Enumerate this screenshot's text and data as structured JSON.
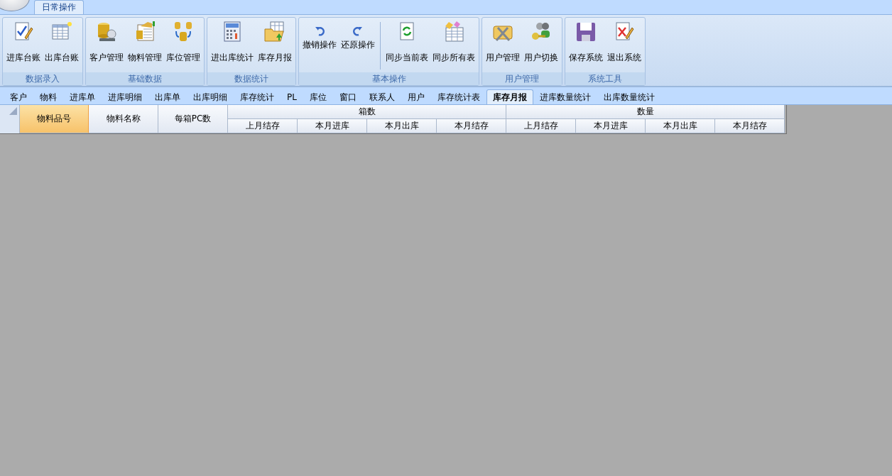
{
  "ribbon_tabs": [
    {
      "label": "日常操作",
      "selected": true
    }
  ],
  "ribbon_groups": [
    {
      "title": "数据录入",
      "buttons": [
        {
          "label": "进库台账",
          "kind": "large"
        },
        {
          "label": "出库台账",
          "kind": "large"
        }
      ]
    },
    {
      "title": "基础数据",
      "buttons": [
        {
          "label": "客户管理",
          "kind": "large"
        },
        {
          "label": "物料管理",
          "kind": "large"
        },
        {
          "label": "库位管理",
          "kind": "large"
        }
      ]
    },
    {
      "title": "数据统计",
      "buttons": [
        {
          "label": "进出库统计",
          "kind": "large"
        },
        {
          "label": "库存月报",
          "kind": "large"
        }
      ]
    },
    {
      "title": "基本操作",
      "buttons": [
        {
          "label": "撤销操作",
          "kind": "small"
        },
        {
          "label": "还原操作",
          "kind": "small"
        },
        {
          "label": "同步当前表",
          "kind": "large"
        },
        {
          "label": "同步所有表",
          "kind": "large"
        }
      ]
    },
    {
      "title": "用户管理",
      "buttons": [
        {
          "label": "用户管理",
          "kind": "large"
        },
        {
          "label": "用户切换",
          "kind": "large"
        }
      ]
    },
    {
      "title": "系统工具",
      "buttons": [
        {
          "label": "保存系统",
          "kind": "large"
        },
        {
          "label": "退出系统",
          "kind": "large"
        }
      ]
    }
  ],
  "document_tabs": [
    {
      "label": "客户",
      "selected": false
    },
    {
      "label": "物料",
      "selected": false
    },
    {
      "label": "进库单",
      "selected": false
    },
    {
      "label": "进库明细",
      "selected": false
    },
    {
      "label": "出库单",
      "selected": false
    },
    {
      "label": "出库明细",
      "selected": false
    },
    {
      "label": "库存统计",
      "selected": false
    },
    {
      "label": "PL",
      "selected": false
    },
    {
      "label": "库位",
      "selected": false
    },
    {
      "label": "窗口",
      "selected": false
    },
    {
      "label": "联系人",
      "selected": false
    },
    {
      "label": "用户",
      "selected": false
    },
    {
      "label": "库存统计表",
      "selected": false
    },
    {
      "label": "库存月报",
      "selected": true
    },
    {
      "label": "进库数量统计",
      "selected": false
    },
    {
      "label": "出库数量统计",
      "selected": false
    }
  ],
  "table": {
    "columns": [
      {
        "label": "物料品号",
        "selected": true
      },
      {
        "label": "物料名称",
        "selected": false
      },
      {
        "label": "每箱PC数",
        "selected": false
      },
      {
        "label": "箱数",
        "selected": false,
        "children": [
          {
            "label": "上月结存"
          },
          {
            "label": "本月进库"
          },
          {
            "label": "本月出库"
          },
          {
            "label": "本月结存"
          }
        ]
      },
      {
        "label": "数量",
        "selected": false,
        "children": [
          {
            "label": "上月结存"
          },
          {
            "label": "本月进库"
          },
          {
            "label": "本月出库"
          },
          {
            "label": "本月结存"
          }
        ]
      }
    ]
  }
}
